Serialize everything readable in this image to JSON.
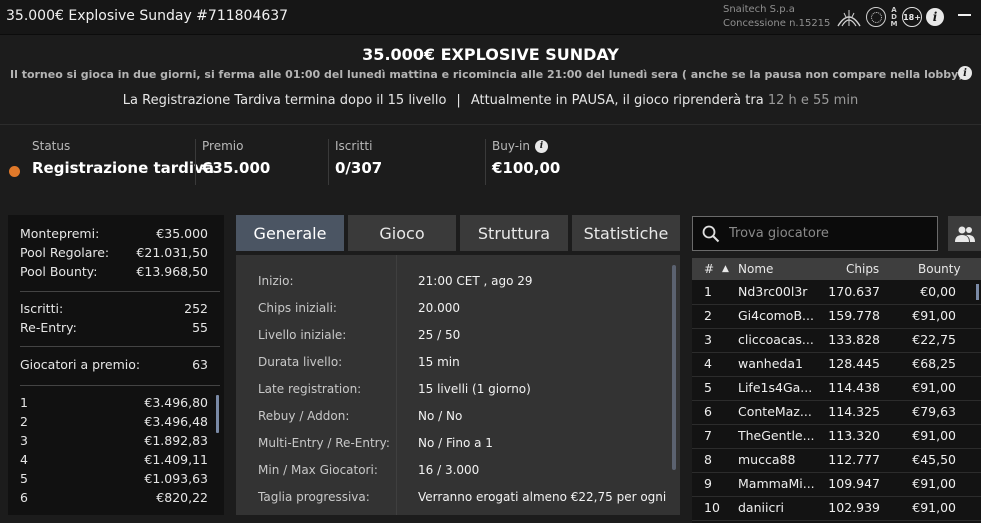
{
  "window": {
    "title": "35.000€ Explosive Sunday #711804637",
    "operator_line1": "Snaitech S.p.a",
    "operator_line2": "Concessione n.15215",
    "age_badge": "18+",
    "adm_letters": "ADM"
  },
  "header": {
    "name": "35.000€ EXPLOSIVE SUNDAY",
    "description": "Il torneo si gioca in due giorni, si ferma alle 01:00 del lunedì mattina e ricomincia alle 21:00 del lunedì sera ( anche se la pausa non compare nella lobby)....",
    "late_reg": "La Registrazione Tardiva termina dopo il 15 livello",
    "separator": "|",
    "pause_text": "Attualmente in PAUSA, il gioco riprenderà tra",
    "pause_timer": "12 h e 55 min"
  },
  "stats": {
    "status_label": "Status",
    "status_value": "Registrazione tardiva",
    "status_color": "#e0792a",
    "premio_label": "Premio",
    "premio_value": "€35.000",
    "iscritti_label": "Iscritti",
    "iscritti_value": "0/307",
    "buyin_label": "Buy-in",
    "buyin_value": "€100,00"
  },
  "prize": {
    "montepremi_label": "Montepremi:",
    "montepremi_value": "€35.000",
    "pool_reg_label": "Pool Regolare:",
    "pool_reg_value": "€21.031,50",
    "pool_bounty_label": "Pool Bounty:",
    "pool_bounty_value": "€13.968,50",
    "iscritti_label": "Iscritti:",
    "iscritti_value": "252",
    "reentry_label": "Re-Entry:",
    "reentry_value": "55",
    "giocatori_label": "Giocatori a premio:",
    "giocatori_value": "63",
    "places": [
      {
        "pos": "1",
        "amount": "€3.496,80"
      },
      {
        "pos": "2",
        "amount": "€3.496,48"
      },
      {
        "pos": "3",
        "amount": "€1.892,83"
      },
      {
        "pos": "4",
        "amount": "€1.409,11"
      },
      {
        "pos": "5",
        "amount": "€1.093,63"
      },
      {
        "pos": "6",
        "amount": "€820,22"
      }
    ]
  },
  "tabs": [
    "Generale",
    "Gioco",
    "Struttura",
    "Statistiche"
  ],
  "general": [
    {
      "k": "Inizio:",
      "v": "21:00 CET , ago 29"
    },
    {
      "k": "Chips iniziali:",
      "v": "20.000"
    },
    {
      "k": "Livello iniziale:",
      "v": "25 / 50"
    },
    {
      "k": "Durata livello:",
      "v": "15 min"
    },
    {
      "k": "Late registration:",
      "v": "15 livelli (1 giorno)"
    },
    {
      "k": "Rebuy / Addon:",
      "v": "No / No"
    },
    {
      "k": "Multi-Entry / Re-Entry:",
      "v": "No / Fino a 1"
    },
    {
      "k": "Min / Max Giocatori:",
      "v": "16 / 3.000"
    },
    {
      "k": "Taglia progressiva:",
      "v": "Verranno erogati almeno €22,75 per ogni"
    }
  ],
  "search": {
    "placeholder": "Trova giocatore"
  },
  "players": {
    "headers": {
      "rank": "#",
      "name": "Nome",
      "chips": "Chips",
      "bounty": "Bounty"
    },
    "rows": [
      {
        "rank": "1",
        "name": "Nd3rc00l3r",
        "chips": "170.637",
        "bounty": "€0,00"
      },
      {
        "rank": "2",
        "name": "Gi4comoB...",
        "chips": "159.778",
        "bounty": "€91,00"
      },
      {
        "rank": "3",
        "name": "cliccoacas...",
        "chips": "133.828",
        "bounty": "€22,75"
      },
      {
        "rank": "4",
        "name": "wanheda1",
        "chips": "128.445",
        "bounty": "€68,25"
      },
      {
        "rank": "5",
        "name": "Life1s4Ga...",
        "chips": "114.438",
        "bounty": "€91,00"
      },
      {
        "rank": "6",
        "name": "ConteMaz...",
        "chips": "114.325",
        "bounty": "€79,63"
      },
      {
        "rank": "7",
        "name": "TheGentle...",
        "chips": "113.320",
        "bounty": "€91,00"
      },
      {
        "rank": "8",
        "name": "mucca88",
        "chips": "112.777",
        "bounty": "€45,50"
      },
      {
        "rank": "9",
        "name": "MammaMi...",
        "chips": "109.947",
        "bounty": "€91,00"
      },
      {
        "rank": "10",
        "name": "daniicri",
        "chips": "102.939",
        "bounty": "€91,00"
      }
    ]
  }
}
